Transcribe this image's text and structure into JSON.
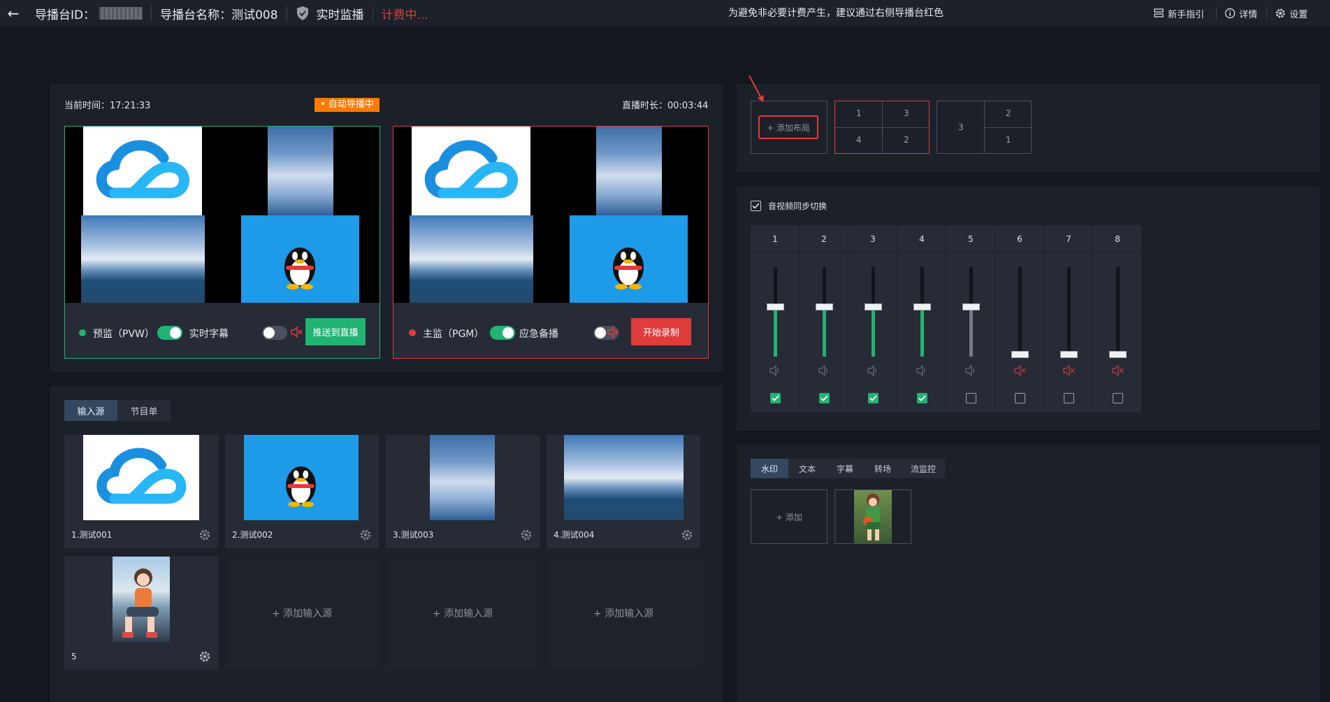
{
  "topbar": {
    "back_label": "←",
    "station_id_label": "导播台ID：",
    "station_name": "导播台名称：测试008",
    "monitor_label": "实时监播",
    "billing_status": "计费中...",
    "notice": "为避免非必要计费产生，建议通过右侧导播台红色",
    "guide_label": "新手指引",
    "detail_label": "详情",
    "settings_label": "设置"
  },
  "preview": {
    "current_time_label": "当前时间：17:21:33",
    "auto_badge": "• 自动导播中",
    "duration_label": "直播时长：00:03:44",
    "pvw_label": "预监（PVW）",
    "subtitle_label": "实时字幕",
    "push_button": "推送到直播",
    "pgm_label": "主监（PGM）",
    "backup_label": "应急备播",
    "record_button": "开始录制"
  },
  "layouts": {
    "add_label": "+ 添加布局",
    "layout_a": [
      "1",
      "3",
      "4",
      "2"
    ],
    "layout_b": [
      "3",
      "2",
      "1"
    ]
  },
  "audio": {
    "sync_label": "音视频同步切换",
    "channels": [
      {
        "num": "1",
        "level": 0.48,
        "active": true,
        "muted": false,
        "checked": true
      },
      {
        "num": "2",
        "level": 0.48,
        "active": true,
        "muted": false,
        "checked": true
      },
      {
        "num": "3",
        "level": 0.48,
        "active": true,
        "muted": false,
        "checked": true
      },
      {
        "num": "4",
        "level": 0.48,
        "active": true,
        "muted": false,
        "checked": true
      },
      {
        "num": "5",
        "level": 0.48,
        "active": false,
        "muted": false,
        "checked": false
      },
      {
        "num": "6",
        "level": 0.0,
        "active": false,
        "muted": true,
        "checked": false
      },
      {
        "num": "7",
        "level": 0.0,
        "active": false,
        "muted": true,
        "checked": false
      },
      {
        "num": "8",
        "level": 0.0,
        "active": false,
        "muted": true,
        "checked": false
      }
    ]
  },
  "sources": {
    "tab_input": "输入源",
    "tab_program": "节目单",
    "items": [
      {
        "label": "1.测试001"
      },
      {
        "label": "2.测试002"
      },
      {
        "label": "3.测试003"
      },
      {
        "label": "4.测试004"
      },
      {
        "label": "5"
      }
    ],
    "add_source_label": "+ 添加输入源"
  },
  "overlay": {
    "tabs": [
      "水印",
      "文本",
      "字幕",
      "转场",
      "流监控"
    ],
    "add_label": "+ 添加"
  },
  "colors": {
    "green": "#22b273",
    "red": "#e03c3c",
    "orange": "#ff7a00"
  }
}
